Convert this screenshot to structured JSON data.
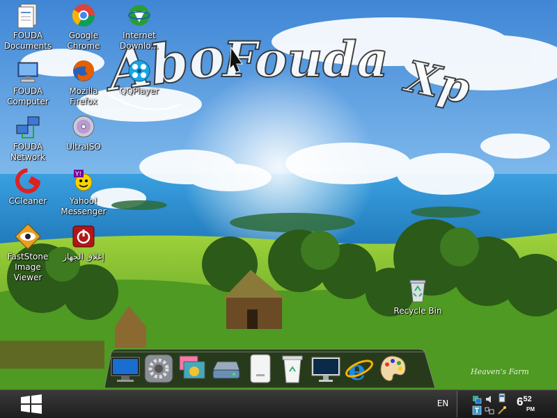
{
  "desktop": {
    "wallpaper": {
      "sky": "#6aa9e6",
      "sea": "#2f8fd0",
      "grass": "#5aa82a",
      "trees": "#2c5a18"
    },
    "watermark_text": "Abo FoudaXp",
    "wallpaper_signature": "Heaven's Farm",
    "icons": [
      {
        "label": "FOUDA Documents",
        "icon": "documents-icon"
      },
      {
        "label": "Google Chrome",
        "icon": "chrome-icon"
      },
      {
        "label": "Internet Downlo...",
        "icon": "idm-icon"
      },
      {
        "label": "FOUDA Computer",
        "icon": "computer-icon"
      },
      {
        "label": "Mozilla Firefox",
        "icon": "firefox-icon"
      },
      {
        "label": "QQPlayer",
        "icon": "qqplayer-icon"
      },
      {
        "label": "FOUDA Network",
        "icon": "network-icon"
      },
      {
        "label": "UltraISO",
        "icon": "ultraiso-icon"
      },
      {
        "label": "CCleaner",
        "icon": "ccleaner-icon"
      },
      {
        "label": "Yahoo! Messenger",
        "icon": "yahoo-messenger-icon"
      },
      {
        "label": "FastStone Image Viewer",
        "icon": "faststone-icon"
      },
      {
        "label": "إغلاق الجهاز",
        "icon": "shutdown-icon"
      },
      {
        "label": "Recycle Bin",
        "icon": "recycle-bin-icon"
      }
    ]
  },
  "dock": {
    "items": [
      {
        "icon": "monitor-icon"
      },
      {
        "icon": "settings-gear-icon"
      },
      {
        "icon": "photo-stack-icon"
      },
      {
        "icon": "drive-icon"
      },
      {
        "icon": "external-drive-icon"
      },
      {
        "icon": "trash-can-icon"
      },
      {
        "icon": "display-icon"
      },
      {
        "icon": "internet-explorer-icon"
      },
      {
        "icon": "paint-palette-icon"
      }
    ]
  },
  "taskbar": {
    "start_icon": "windows-logo-icon",
    "language": "EN",
    "clock": {
      "hour": "6",
      "minute": "52",
      "ampm": "PM"
    },
    "tray_icons": [
      "network-status-icon",
      "volume-icon",
      "power-icon",
      "notes-icon",
      "action-center-icon",
      "wand-icon"
    ]
  }
}
